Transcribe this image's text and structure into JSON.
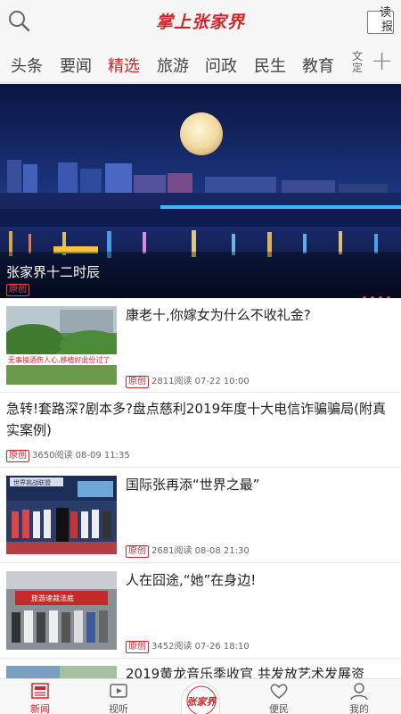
{
  "header": {
    "title": "掌上张家界",
    "read_label_1": "读",
    "read_label_2": "报"
  },
  "tabs": [
    "头条",
    "要闻",
    "精选",
    "旅游",
    "问政",
    "民生",
    "教育"
  ],
  "tab_more": "文定",
  "active_tab": "精选",
  "banner": {
    "title": "张家界十二时辰",
    "badge": "原创"
  },
  "articles": [
    {
      "title": "康老十,你嫁女为什么不收礼金?",
      "badge": "原创",
      "views": "2811阅读",
      "date": "07-22 10:00",
      "thumb_caption": "无事搞酒伤人心,移植好此份过了"
    },
    {
      "title": "急转!套路深?剧本多?盘点慈利2019年度十大电信诈骗骗局(附真实案例)",
      "badge": "原创",
      "views": "3650阅读",
      "date": "08-09 11:35"
    },
    {
      "title": "国际张再添“世界之最”",
      "badge": "原创",
      "views": "2681阅读",
      "date": "08-08 21:30",
      "thumb_caption": "世界挑战联盟"
    },
    {
      "title": "人在囧途,“她”在身边!",
      "badge": "原创",
      "views": "3452阅读",
      "date": "07-26 18:10",
      "thumb_caption": "旅游速裁法庭"
    },
    {
      "title": "2019黄龙音乐季收官 共发放艺术发展资"
    }
  ],
  "bottom_nav": [
    {
      "label": "新闻",
      "icon": "news-icon"
    },
    {
      "label": "视听",
      "icon": "video-icon"
    },
    {
      "label": "",
      "icon": "center-logo"
    },
    {
      "label": "便民",
      "icon": "heart-icon"
    },
    {
      "label": "我的",
      "icon": "user-icon"
    }
  ],
  "center_logo_text": "张家界",
  "colors": {
    "accent": "#d0252b"
  }
}
